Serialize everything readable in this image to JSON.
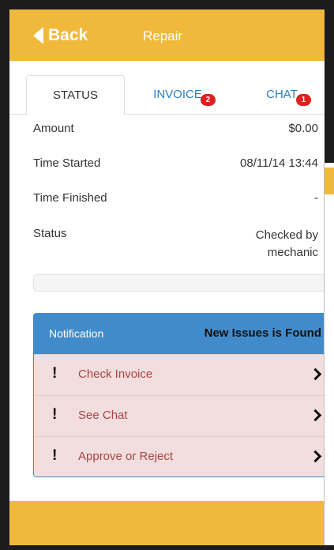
{
  "header": {
    "back_label": "Back",
    "title": "Repair"
  },
  "tabs": [
    {
      "label": "STATUS",
      "badge": null
    },
    {
      "label": "INVOICE",
      "badge": "2"
    },
    {
      "label": "CHAT",
      "badge": "1"
    }
  ],
  "details": [
    {
      "label": "Amount",
      "value": "$0.00"
    },
    {
      "label": "Time Started",
      "value": "08/11/14 13:44"
    },
    {
      "label": "Time Finished",
      "value": "-"
    },
    {
      "label": "Status",
      "value_line1": "Checked by",
      "value_line2": "mechanic"
    }
  ],
  "notification": {
    "title": "Notification",
    "message": "New Issues is Found",
    "items": [
      {
        "label": "Check Invoice"
      },
      {
        "label": "See Chat"
      },
      {
        "label": "Approve or Reject"
      }
    ]
  },
  "colors": {
    "header": "#f0b93b",
    "link": "#2a7fc5",
    "badge": "#e0201e",
    "panel": "#428bca",
    "alert_bg": "#f2dede",
    "alert_text": "#a94442"
  },
  "icons": {
    "back": "back-arrow-icon",
    "item_marker": "exclamation-icon",
    "item_nav": "chevron-right-icon"
  }
}
